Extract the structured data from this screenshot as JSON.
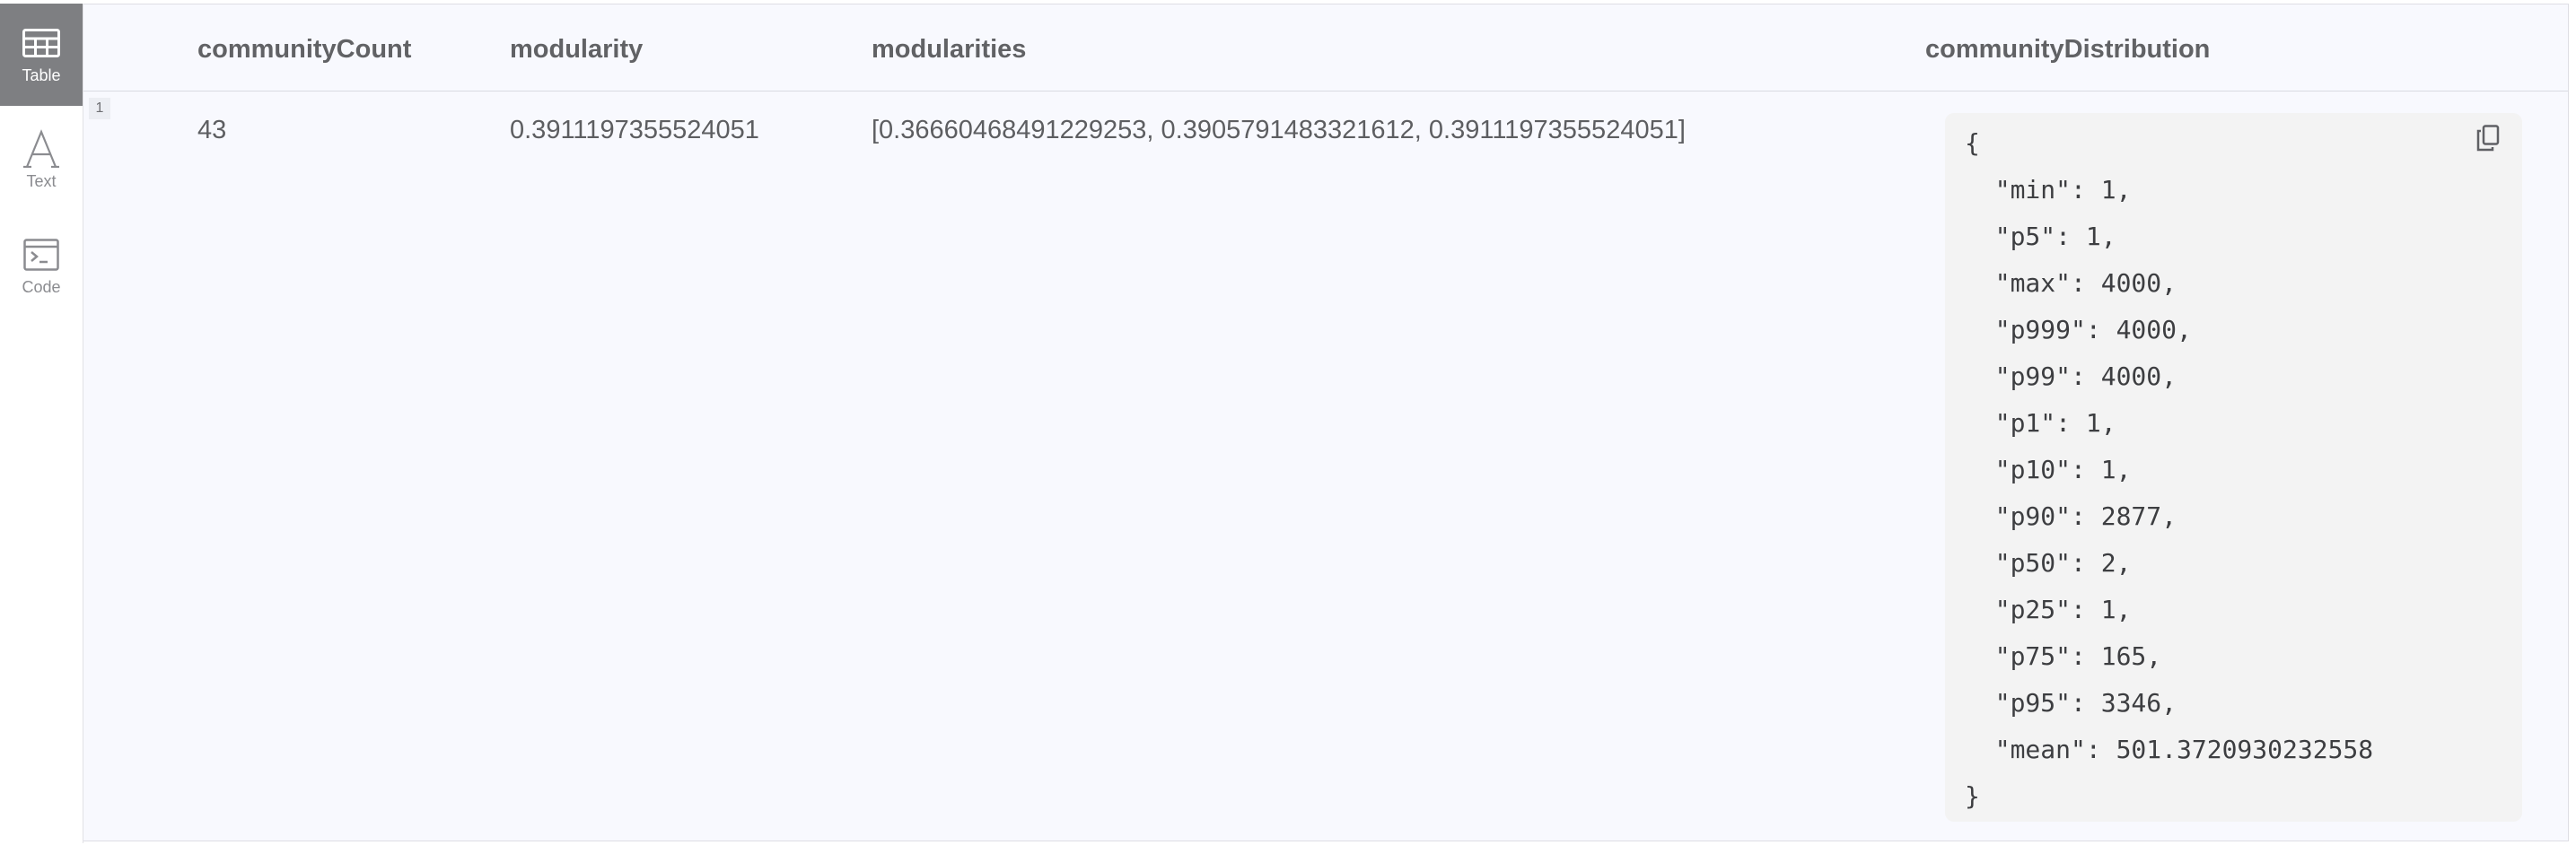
{
  "sidebar": {
    "items": [
      {
        "label": "Table",
        "icon": "table-icon",
        "active": true
      },
      {
        "label": "Text",
        "icon": "text-icon",
        "active": false
      },
      {
        "label": "Code",
        "icon": "code-icon",
        "active": false
      }
    ]
  },
  "table": {
    "columns": [
      "communityCount",
      "modularity",
      "modularities",
      "communityDistribution"
    ],
    "rows": [
      {
        "index": "1",
        "communityCount": "43",
        "modularity": "0.3911197355524051",
        "modularities": "[0.36660468491229253, 0.3905791483321612, 0.3911197355524051]",
        "communityDistribution": "{\n  \"min\": 1,\n  \"p5\": 1,\n  \"max\": 4000,\n  \"p999\": 4000,\n  \"p99\": 4000,\n  \"p1\": 1,\n  \"p10\": 1,\n  \"p90\": 2877,\n  \"p50\": 2,\n  \"p25\": 1,\n  \"p75\": 165,\n  \"p95\": 3346,\n  \"mean\": 501.3720930232558\n}"
      }
    ]
  },
  "colors": {
    "accent_active": "#7e7f82",
    "panel_bg": "#f8f9fe",
    "code_bg": "#f3f3f3"
  },
  "icons": {
    "copy": "copy-icon"
  }
}
